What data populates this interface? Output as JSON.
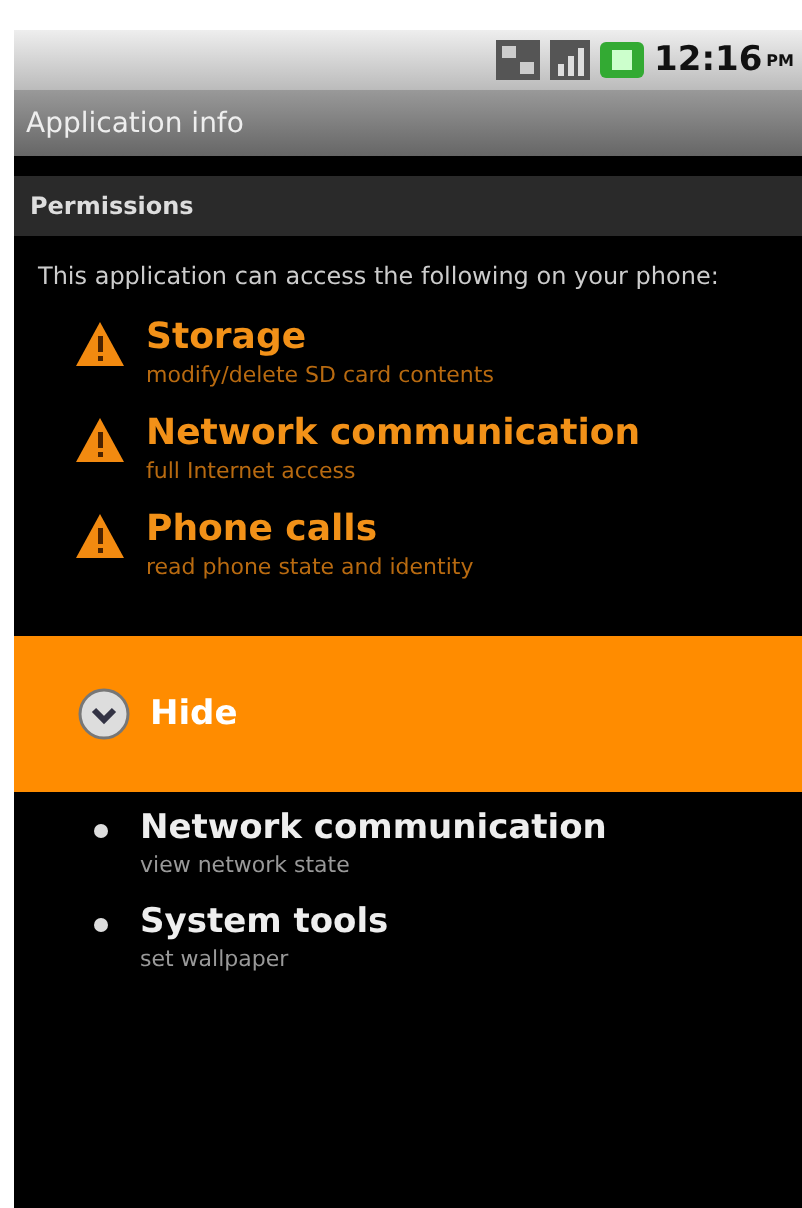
{
  "status_bar": {
    "time": "12:16",
    "ampm": "PM"
  },
  "title_bar": {
    "title": "Application info"
  },
  "section": {
    "title": "Permissions"
  },
  "intro": "This application can access the following on your phone:",
  "dangerous_permissions": [
    {
      "name": "Storage",
      "description": "modify/delete SD card contents"
    },
    {
      "name": "Network communication",
      "description": "full Internet access"
    },
    {
      "name": "Phone calls",
      "description": "read phone state and identity"
    }
  ],
  "toggle": {
    "label": "Hide"
  },
  "other_permissions": [
    {
      "name": "Network communication",
      "description": "view network state"
    },
    {
      "name": "System tools",
      "description": "set wallpaper"
    }
  ]
}
